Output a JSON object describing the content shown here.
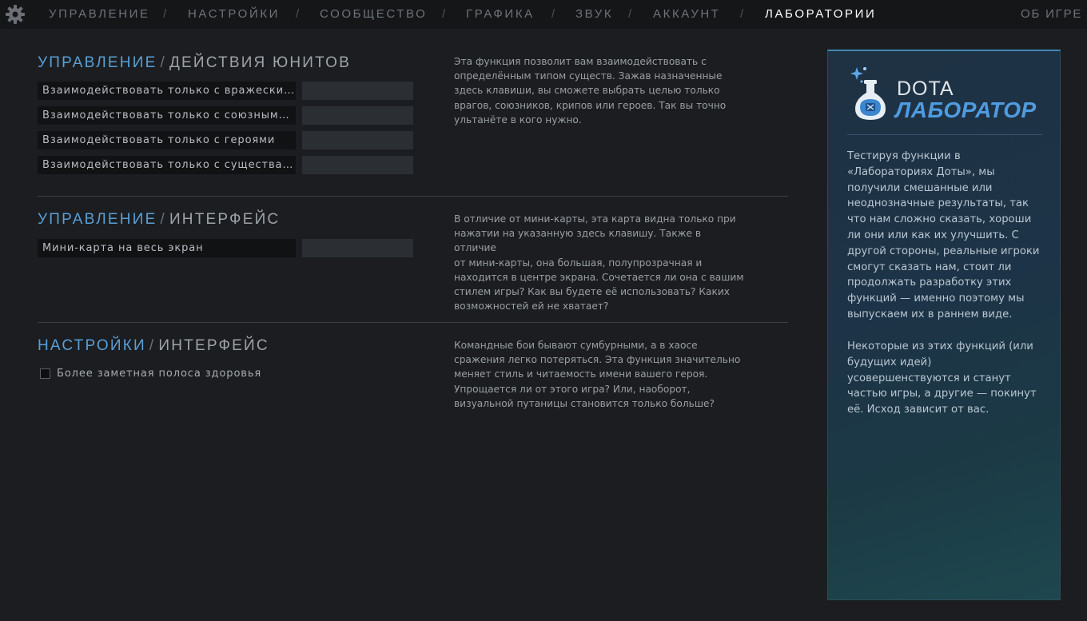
{
  "nav": {
    "items": [
      "УПРАВЛЕНИЕ",
      "НАСТРОЙКИ",
      "СООБЩЕСТВО",
      "ГРАФИКА",
      "ЗВУК",
      "АККАУНТ",
      "ЛАБОРАТОРИИ"
    ],
    "separator": "/",
    "active": "ЛАБОРАТОРИИ",
    "about": "ОБ ИГРЕ"
  },
  "sections": [
    {
      "category": "УПРАВЛЕНИЕ",
      "separator": "/",
      "subcategory": "ДЕЙСТВИЯ ЮНИТОВ",
      "bindings": [
        {
          "label": "Взаимодействовать только с вражескими",
          "key": ""
        },
        {
          "label": "Взаимодействовать только с союзными юнитами",
          "key": ""
        },
        {
          "label": "Взаимодействовать только с героями",
          "key": ""
        },
        {
          "label": "Взаимодействовать только с существами",
          "key": ""
        }
      ],
      "description": "Эта функция позволит вам взаимодействовать с\nопределённым типом существ. Зажав назначенные\nздесь клавиши, вы сможете выбрать целью только\nврагов, союзников, крипов или героев. Так вы точно\nультанёте в кого нужно."
    },
    {
      "category": "УПРАВЛЕНИЕ",
      "separator": "/",
      "subcategory": "ИНТЕРФЕЙС",
      "bindings": [
        {
          "label": "Мини-карта на весь экран",
          "key": ""
        }
      ],
      "description": "В отличие от мини-карты, эта карта видна только при\nнажатии на указанную здесь клавишу. Также в отличие\nот мини-карты, она большая, полупрозрачная и\nнаходится в центре экрана. Сочетается ли она с вашим\nстилем игры? Как вы будете её использовать? Каких\nвозможностей ей не хватает?"
    },
    {
      "category": "НАСТРОЙКИ",
      "separator": "/",
      "subcategory": "ИНТЕРФЕЙС",
      "checkbox": {
        "label": "Более заметная полоса здоровья",
        "checked": false
      },
      "description": "Командные бои бывают сумбурными, а в хаосе\nсражения легко потеряться. Эта функция значительно\nменяет стиль и читаемость имени вашего героя.\nУпрощается ли от этого игра? Или, наоборот,\nвизуальной путаницы становится только больше?"
    }
  ],
  "lab_panel": {
    "logo_top": "DOTA",
    "logo_bottom": "ЛАБОРАТОР",
    "paragraph1": "Тестируя функции в «Лабораториях Доты», мы получили смешанные или неоднозначные результаты, так что нам сложно сказать, хороши ли они или как их улучшить. С другой стороны, реальные игроки смогут сказать нам, стоит ли продолжать разработку этих функций — именно поэтому мы выпускаем их в раннем виде.",
    "paragraph2": "Некоторые из этих функций (или будущих идей) усовершенствуются и станут частью игры, а другие — покинут её. Исход зависит от вас."
  },
  "colors": {
    "accent": "#5a9fd6",
    "background": "#1b1d20",
    "topbar": "#151618",
    "panel": "#1f3244"
  },
  "icons": {
    "settings": "gear-icon",
    "logo": "flask-icon"
  }
}
